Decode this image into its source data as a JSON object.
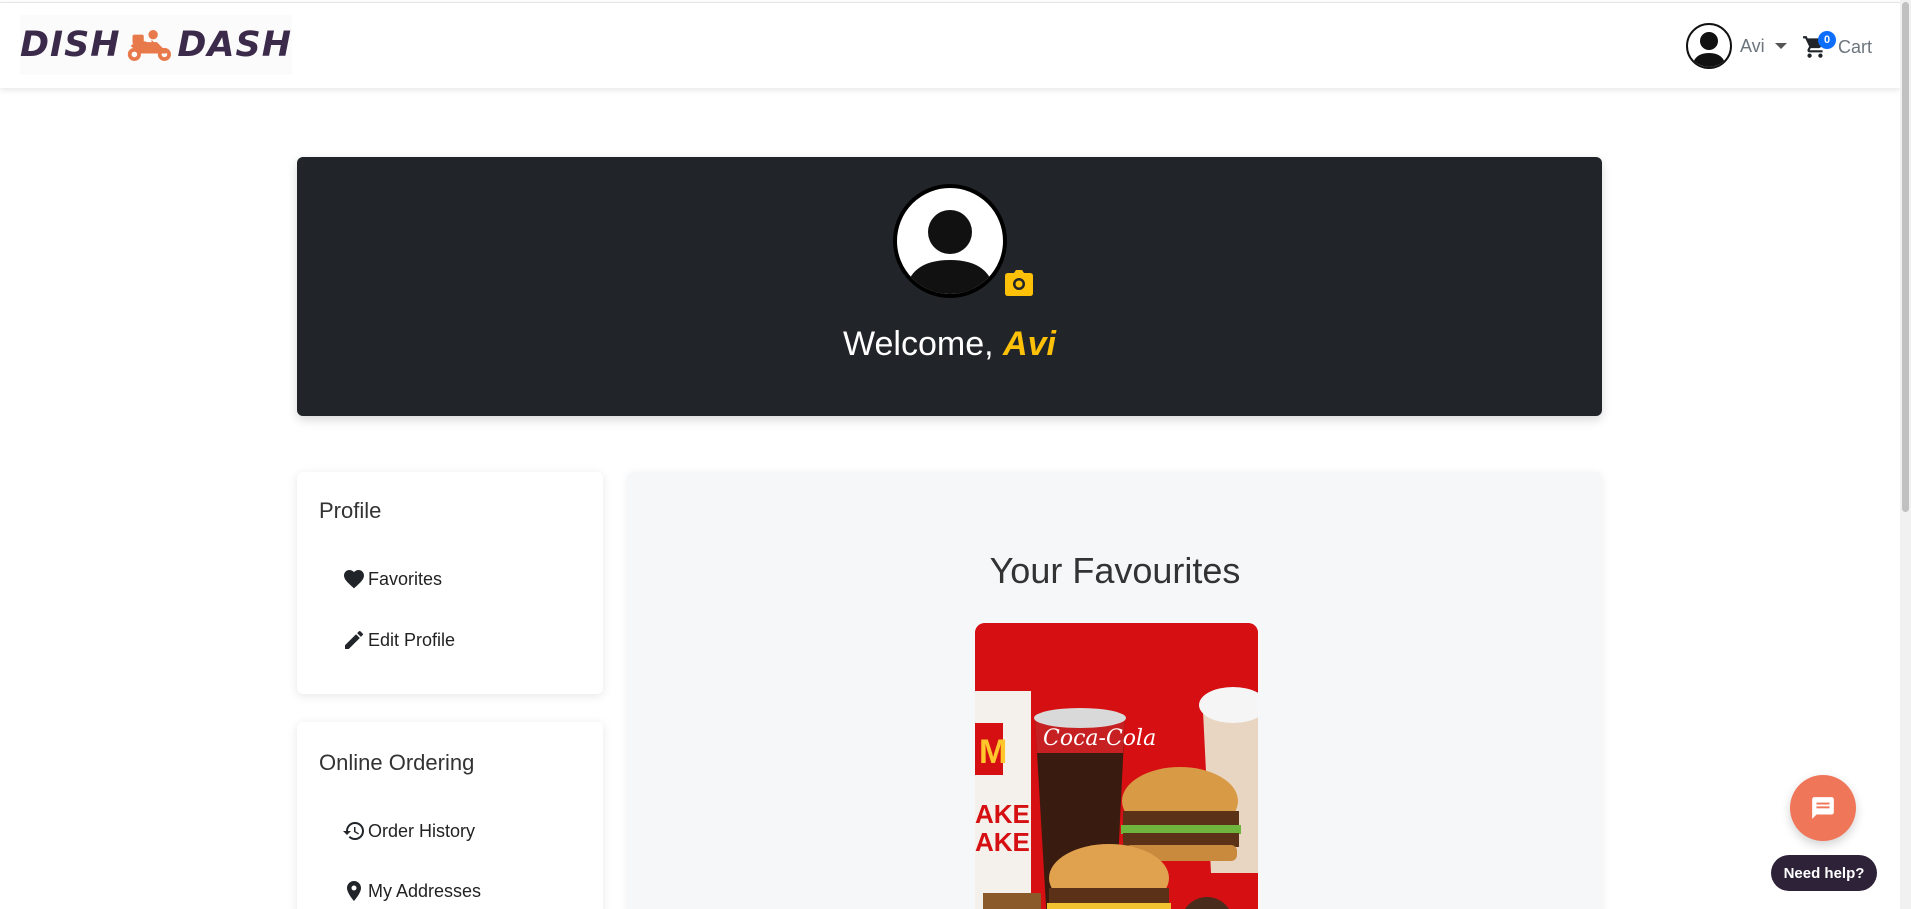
{
  "brand": {
    "name_left": "DISH",
    "name_right": "DASH",
    "logo_color": "#3b2a4a",
    "scooter_color": "#e8794a"
  },
  "navbar": {
    "user_name": "Avi",
    "cart_label": "Cart",
    "cart_count": "0"
  },
  "banner": {
    "welcome_prefix": "Welcome,",
    "user_name": "Avi",
    "background": "#212529",
    "accent": "#ffc107"
  },
  "sidebar": {
    "profile": {
      "title": "Profile",
      "items": [
        {
          "label": "Favorites",
          "icon": "heart-icon"
        },
        {
          "label": "Edit Profile",
          "icon": "pencil-icon"
        }
      ]
    },
    "ordering": {
      "title": "Online Ordering",
      "items": [
        {
          "label": "Order History",
          "icon": "history-icon"
        },
        {
          "label": "My Addresses",
          "icon": "location-pin-icon"
        }
      ]
    }
  },
  "main": {
    "title": "Your Favourites"
  },
  "chat": {
    "help_label": "Need help?",
    "button_color": "#f0765a"
  }
}
